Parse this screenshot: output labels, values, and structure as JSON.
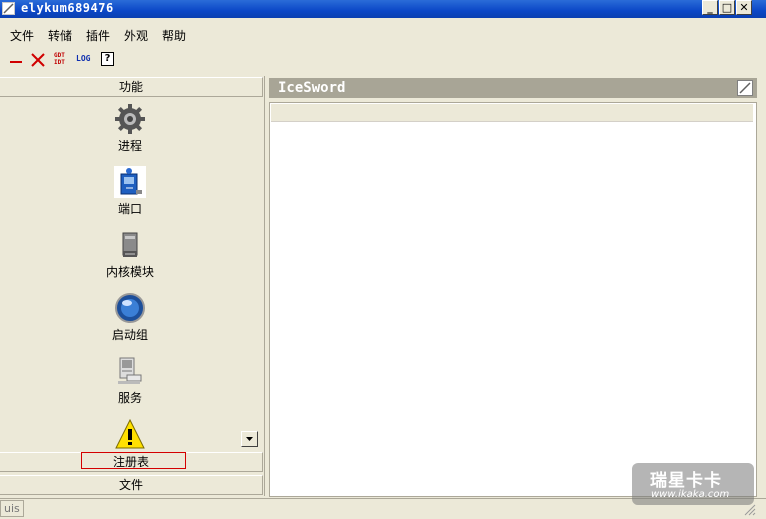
{
  "window": {
    "title": "elykum689476",
    "caption_buttons": [
      "_",
      "□",
      "✕"
    ]
  },
  "menu": {
    "items": [
      "文件",
      "转储",
      "插件",
      "外观",
      "帮助"
    ]
  },
  "toolbar": {
    "gdt_idt_line1": "GDT",
    "gdt_idt_line2": "IDT",
    "log_label": "LOG",
    "help_label": "?"
  },
  "left_panel": {
    "header": "功能",
    "items": [
      {
        "label": "进程",
        "icon": "gear-icon"
      },
      {
        "label": "端口",
        "icon": "port-icon"
      },
      {
        "label": "内核模块",
        "icon": "disk-icon"
      },
      {
        "label": "启动组",
        "icon": "globe-icon"
      },
      {
        "label": "服务",
        "icon": "computer-icon"
      },
      {
        "label": "",
        "icon": "warning-icon"
      }
    ],
    "registry_section": "注册表",
    "file_section": "文件"
  },
  "right_panel": {
    "title": "IceSword"
  },
  "statusbar": {
    "text": "uis"
  },
  "watermark": {
    "title": "瑞星卡卡",
    "url": "www.ikaka.com"
  },
  "colors": {
    "titlebar": "#0b47c7",
    "window_bg": "#ece9d8",
    "panel_header": "#a8a596",
    "highlight_box": "#d40000"
  }
}
